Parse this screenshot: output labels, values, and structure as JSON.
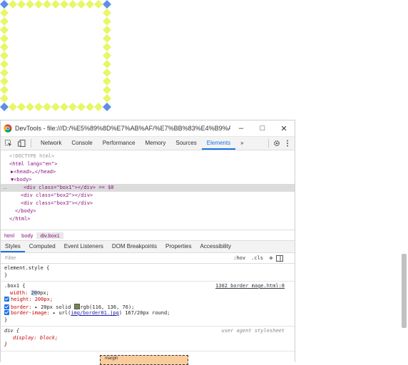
{
  "colors": {
    "border_yellow": "#e6f767",
    "corner_blue": "#5f8de8",
    "accent": "#1a73e8",
    "swatch": "rgb(116, 136, 76)"
  },
  "devtools": {
    "window_title": "DevTools - file:///D:/%E5%89%8D%E7%AB%AF/%E7%BB%83%E4%B9%A0/L30...",
    "win_buttons": {
      "minimize": "–",
      "maximize": "□",
      "close": "✕"
    },
    "tabs": [
      "Network",
      "Console",
      "Performance",
      "Memory",
      "Sources",
      "Elements"
    ],
    "more_tabs": "»",
    "dom_lines": {
      "doctype": "<!DOCTYPE html>",
      "html_open": "<html lang=\"en\">",
      "head": "▶<head>…</head>",
      "body_open": "▼<body>",
      "box1": "<div class=\"box1\"></div> == $0",
      "box2": "<div class=\"box2\"></div>",
      "box3": "<div class=\"box3\"></div>",
      "body_close": "</body>",
      "html_close": "</html>",
      "ellipsis": "…"
    },
    "breadcrumbs": [
      "html",
      "body",
      "div.box1"
    ],
    "subtabs": [
      "Styles",
      "Computed",
      "Event Listeners",
      "DOM Breakpoints",
      "Properties",
      "Accessibility"
    ],
    "filter": {
      "placeholder": "Filter",
      "hov": ":hov",
      "cls": ".cls",
      "plus": "+"
    },
    "element_style": {
      "open": "element.style {",
      "close": "}"
    },
    "box1_rule": {
      "selector": ".box1 {",
      "source": "1302 border_mage.html:8",
      "width_prop": "width:",
      "width_val": "20",
      "width_val_rest": "0px;",
      "height": "height: 200px;",
      "border_prop": "border:",
      "border_val": "▸ 20px solid",
      "border_color": "rgb(116, 136, 76);",
      "border_image_prop": "border-image:",
      "border_image_pre": "▸ url(",
      "border_image_link": "img/border01.jpg",
      "border_image_post": ") 167/20px round;",
      "close": "}"
    },
    "ua_rule": {
      "selector": "div {",
      "source": "user agent stylesheet",
      "display": "display: block;",
      "close": "}"
    },
    "box_model_label": "margin"
  }
}
